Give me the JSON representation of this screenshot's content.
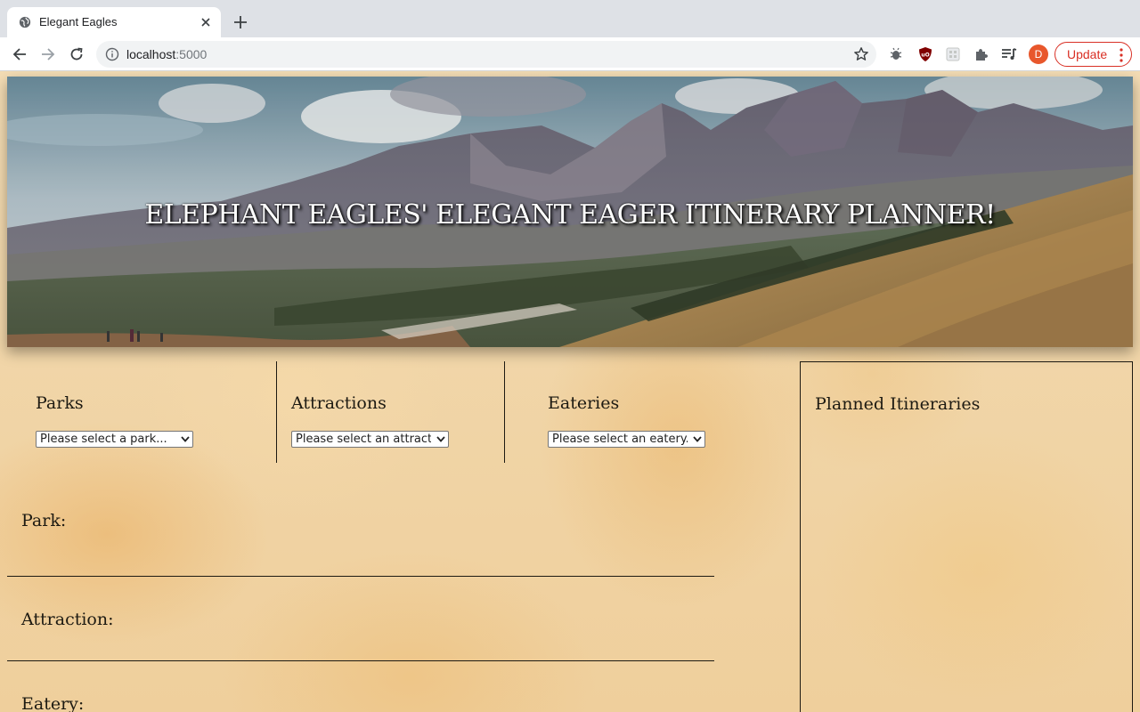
{
  "browser": {
    "tab_title": "Elegant Eagles",
    "url_host": "localhost",
    "url_port": ":5000",
    "update_label": "Update",
    "avatar_letter": "D"
  },
  "hero": {
    "title": "ELEPHANT EAGLES' ELEGANT EAGER ITINERARY PLANNER!"
  },
  "selectors": [
    {
      "label": "Parks",
      "placeholder": "Please select a park..."
    },
    {
      "label": "Attractions",
      "placeholder": "Please select an attraction..."
    },
    {
      "label": "Eateries",
      "placeholder": "Please select an eatery..."
    }
  ],
  "details": {
    "park_label": "Park:",
    "attraction_label": "Attraction:",
    "eatery_label": "Eatery:"
  },
  "itineraries": {
    "title": "Planned Itineraries"
  },
  "colors": {
    "accent_red": "#d93025",
    "avatar": "#e8572c",
    "text_dark": "#1d1a12"
  }
}
